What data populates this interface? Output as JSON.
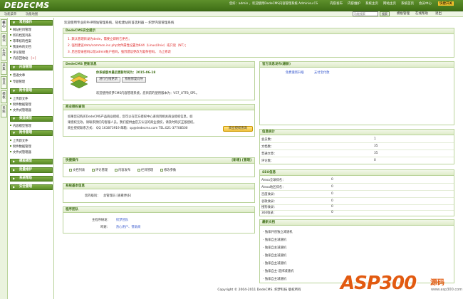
{
  "header": {
    "logo": "DEDECMS",
    "version": "V5.7",
    "user_info": "您好：admin ，欢迎使用DedeCMS内容管理系统 Adminisu.CS",
    "menu": [
      "核心",
      "模块",
      "生成",
      "采集",
      "会员",
      "模板",
      "系统"
    ],
    "menu_top": [
      "内容发布",
      "内容维护",
      "系统主页",
      "网站主页",
      "系统首页",
      "会员中心",
      "快捷开关"
    ],
    "sub_left": [
      "功能菜单",
      "功能地图"
    ],
    "search_placeholder": "功能搜索",
    "search_btn": "搜索",
    "right_links": [
      "模板管理",
      "在线帮助",
      "退出"
    ]
  },
  "vtabs": [
    "核心",
    "模块",
    "生成",
    "采集",
    "会员",
    "模板",
    "系统"
  ],
  "sidebar": {
    "groups": [
      {
        "title": "常用操作",
        "items": [
          "网站栏目管理",
          "所有档案列表",
          "等审核的档案",
          "我发布的文档",
          "评论管理",
          "内容回收站"
        ]
      },
      {
        "title": "内容管理",
        "items": [
          "普通文章",
          "专题管理"
        ]
      },
      {
        "title": "附件管理",
        "items": [
          "上传新文件",
          "附件数据管理",
          "文件式管理器"
        ]
      },
      {
        "title": "频道模型",
        "items": [
          "内容模型管理",
          "单页文档管理",
          "联动类别管理",
          "自由列表管理",
          "自定义表单"
        ]
      },
      {
        "title": "附件管理",
        "items": [
          "上传新文件",
          "附件数据管理",
          "文件式管理器"
        ]
      },
      {
        "title": "模板模型",
        "items": []
      },
      {
        "title": "批量维护",
        "items": []
      },
      {
        "title": "系统帮助",
        "items": []
      },
      {
        "title": "安全管理",
        "items": []
      }
    ],
    "star": "[+]"
  },
  "main": {
    "crumb": "欢迎使用专业的PHP网站管理系统，轻松建站的首选利器 -- 织梦内容管理系统",
    "security": {
      "title": "DedeCMS安全提示",
      "lines": [
        "1. 默认管理目录为dede，需要立即将它更名；",
        "2. 强烈建议data/common.inc.php文件属性设置为644（Linux/Unix）或只读（NT）；",
        "3. 后台登录密码以及admin账户密码，强烈建议更改为复杂密码。 马上修改"
      ]
    },
    "update": {
      "title": "DedeCMS 更新消息",
      "msg": "你系统版本最后更新时间为：2015-06-18",
      "btn1": "进行在线更新",
      "btn2": "系统修复向导",
      "desc": "欢迎使用织梦CMS内容管理系统，您目前的使用版本为：V57_UTF8_SP1。"
    },
    "official": {
      "title": "官方消息发布(最新)",
      "items": [
        "免费重新升级",
        "支付宝付款"
      ]
    },
    "license": {
      "title": "商业授权查询",
      "text1": "如果您已购买DedeCMS产品商业授权，您可以在官方授权中心查询到相关商业授权信息，如",
      "text2": "果授权无效，请联系我们的客服人员。我们提供由官方认证的商业授权，请及时购买正版授权。",
      "text3": "商业授权联系方式： QQ 163873919 邮箱：sp@dedecms.com TEL:021-37708500",
      "btn": "商业授权查询"
    },
    "stats": {
      "title": "信息统计",
      "rows": [
        [
          "会员数：",
          "1"
        ],
        [
          "文档数：",
          "35"
        ],
        [
          "普通文章：",
          "35"
        ],
        [
          "评论数：",
          "0"
        ]
      ]
    },
    "quick": {
      "title": "快捷操作",
      "extra": "[新增] [管理]",
      "items": [
        "文档列表",
        "评论管理",
        "内容发布",
        "栏目管理",
        "修改参数"
      ]
    },
    "seo": {
      "title": "SEO信息",
      "rows": [
        [
          "Alexa全球排名：",
          "0"
        ],
        [
          "Alexa地区排名：",
          "0"
        ],
        [
          "百度收录：",
          "0"
        ],
        [
          "谷歌收录：",
          "0"
        ],
        [
          "搜狗收录：",
          "0"
        ],
        [
          "360收录：",
          "0"
        ]
      ]
    },
    "sysinfo": {
      "title": "系统基本信息",
      "label": "您的级别：",
      "value": "总管理员 [查看更多]"
    },
    "team": {
      "title": "程序团队",
      "k1": "主程序研发：",
      "v1": "织梦团队",
      "k2": "鸣谢：",
      "v2": "热心用户、赞助商"
    },
    "docs": {
      "title": "最新文档",
      "items": [
        "- 独家开创独立减速机",
        "- 独家自主减速机",
        "- 独家自主减速机",
        "- 独家自主减速机",
        "- 独家自主减速机",
        "- 独家自主-选择减速机",
        "- 独家自主减速机"
      ]
    }
  },
  "footer": "Copyright © 2004-2011 DedeCMS. 织梦科技 版权所有",
  "watermark": {
    "brand": "ASP300",
    "suffix": "源码",
    "site": "www.asp300.com"
  },
  "colors": {
    "accent": "#5a8b27",
    "warning": "#d22222",
    "stats_link": "#3355cc"
  }
}
